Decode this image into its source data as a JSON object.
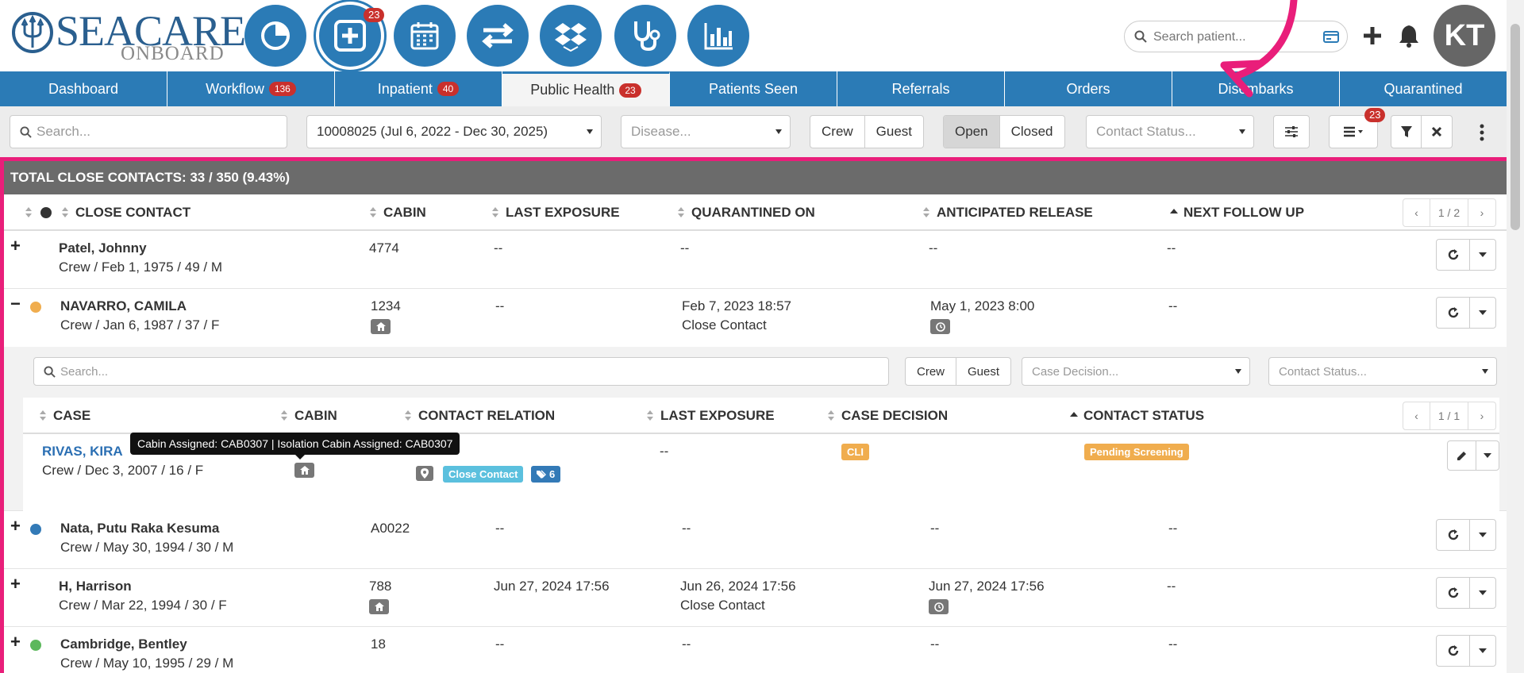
{
  "header": {
    "logo_main": "SEACARE",
    "logo_sub": "ONBOARD",
    "add_badge": "23",
    "search_placeholder": "Search patient...",
    "avatar_initials": "KT",
    "modules": [
      "dashboard-pie-icon",
      "add-case-icon",
      "calendar-icon",
      "transfer-icon",
      "dropbox-icon",
      "stethoscope-icon",
      "bar-chart-icon"
    ]
  },
  "tabs": [
    {
      "label": "Dashboard",
      "badge": ""
    },
    {
      "label": "Workflow",
      "badge": "136"
    },
    {
      "label": "Inpatient",
      "badge": "40"
    },
    {
      "label": "Public Health",
      "badge": "23"
    },
    {
      "label": "Patients Seen",
      "badge": ""
    },
    {
      "label": "Referrals",
      "badge": ""
    },
    {
      "label": "Orders",
      "badge": ""
    },
    {
      "label": "Disembarks",
      "badge": ""
    },
    {
      "label": "Quarantined",
      "badge": ""
    }
  ],
  "filters": {
    "search_placeholder": "Search...",
    "voyage": "10008025 (Jul 6, 2022 - Dec 30, 2025)",
    "disease_placeholder": "Disease...",
    "crew": "Crew",
    "guest": "Guest",
    "open": "Open",
    "closed": "Closed",
    "contact_status_placeholder": "Contact Status...",
    "menu_badge": "23"
  },
  "panel": {
    "title": "TOTAL CLOSE CONTACTS: 33 / 350 (9.43%)",
    "columns": [
      "CLOSE CONTACT",
      "CABIN",
      "LAST EXPOSURE",
      "QUARANTINED ON",
      "ANTICIPATED RELEASE",
      "NEXT FOLLOW UP"
    ],
    "pager": "1 / 2"
  },
  "rows": [
    {
      "name": "Patel, Johnny",
      "sub": "Crew / Feb 1, 1975 / 49 / M",
      "cabin": "4774",
      "last_exposure": "--",
      "quarantined_on": "--",
      "quarantined_note": "",
      "release": "--",
      "follow_up": "--",
      "dot": "",
      "expander": "+"
    },
    {
      "name": "NAVARRO, CAMILA",
      "sub": "Crew / Jan 6, 1987 / 37 / F",
      "cabin": "1234",
      "last_exposure": "--",
      "quarantined_on": "Feb 7, 2023 18:57",
      "quarantined_note": "Close Contact",
      "release": "May 1, 2023 8:00",
      "follow_up": "--",
      "dot": "#f0ad4e",
      "expander": "−"
    },
    {
      "name": "Nata, Putu Raka Kesuma",
      "sub": "Crew / May 30, 1994 / 30 / M",
      "cabin": "A0022",
      "last_exposure": "--",
      "quarantined_on": "--",
      "quarantined_note": "",
      "release": "--",
      "follow_up": "--",
      "dot": "#337ab7",
      "expander": "+"
    },
    {
      "name": "H, Harrison",
      "sub": "Crew / Mar 22, 1994 / 30 / F",
      "cabin": "788",
      "last_exposure": "Jun 27, 2024 17:56",
      "quarantined_on": "Jun 26, 2024 17:56",
      "quarantined_note": "Close Contact",
      "release": "Jun 27, 2024 17:56",
      "follow_up": "--",
      "dot": "",
      "expander": "+"
    },
    {
      "name": "Cambridge, Bentley",
      "sub": "Crew / May 10, 1995 / 29 / M",
      "cabin": "18",
      "last_exposure": "--",
      "quarantined_on": "--",
      "quarantined_note": "",
      "release": "--",
      "follow_up": "--",
      "dot": "#5cb85c",
      "expander": "+"
    }
  ],
  "subtable": {
    "search_placeholder": "Search...",
    "crew": "Crew",
    "guest": "Guest",
    "case_decision_placeholder": "Case Decision...",
    "contact_status_placeholder": "Contact Status...",
    "columns": [
      "CASE",
      "CABIN",
      "CONTACT RELATION",
      "LAST EXPOSURE",
      "CASE DECISION",
      "CONTACT STATUS"
    ],
    "pager": "1 / 1",
    "row": {
      "name": "RIVAS, KIRA",
      "sub": "Crew / Dec 3, 2007 / 16 / F",
      "last_exposure": "--",
      "relation_label": "Close Contact",
      "tag_count": "6",
      "case_decision": "CLI",
      "contact_status": "Pending Screening"
    },
    "tooltip": "Cabin Assigned: CAB0307 | Isolation Cabin Assigned: CAB0307"
  },
  "colors": {
    "primary": "#2b7bb6",
    "highlight": "#e91e7a",
    "badge": "#c9302c",
    "cli": "#f0ad4e",
    "close_contact": "#5bc0de",
    "tag": "#337ab7"
  }
}
